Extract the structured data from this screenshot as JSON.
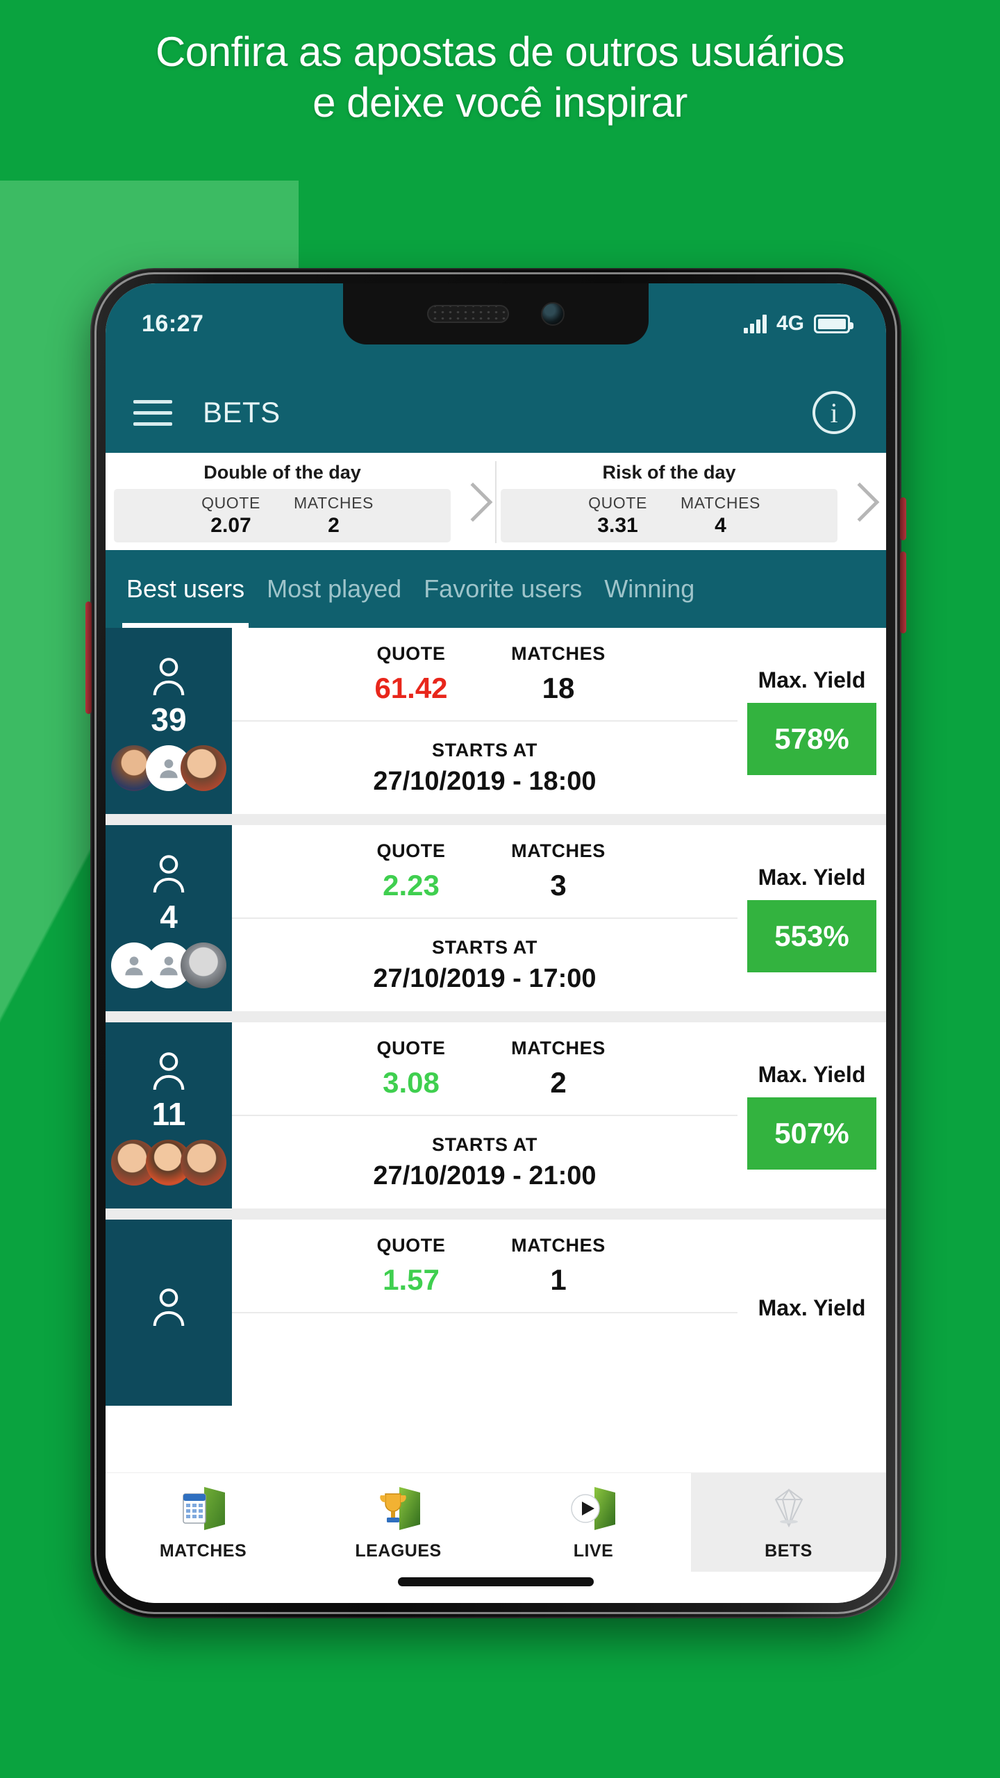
{
  "promo_banner": {
    "line1": "Confira as apostas de outros usuários",
    "line2": "e deixe você inspirar"
  },
  "colors": {
    "background_green": "#0aa33f",
    "teal_header": "#10606e",
    "teal_sidebar": "#0e4a5c",
    "yield_green": "#33b33f",
    "quote_red": "#e8261b",
    "quote_green": "#3fcf4f"
  },
  "status_bar": {
    "time": "16:27",
    "network": "4G",
    "signal_icon": "signal-bars-icon",
    "battery_icon": "battery-icon"
  },
  "app_bar": {
    "menu_icon": "hamburger-menu-icon",
    "title": "BETS",
    "info_icon": "info-icon",
    "info_glyph": "i"
  },
  "promos": [
    {
      "title": "Double of the day",
      "quote_label": "QUOTE",
      "quote_value": "2.07",
      "matches_label": "MATCHES",
      "matches_value": "2",
      "chevron_icon": "chevron-right-icon"
    },
    {
      "title": "Risk of the day",
      "quote_label": "QUOTE",
      "quote_value": "3.31",
      "matches_label": "MATCHES",
      "matches_value": "4",
      "chevron_icon": "chevron-right-icon"
    }
  ],
  "tabs": [
    {
      "label": "Best users",
      "active": true
    },
    {
      "label": "Most played",
      "active": false
    },
    {
      "label": "Favorite users",
      "active": false
    },
    {
      "label": "Winning",
      "active": false
    }
  ],
  "labels": {
    "quote": "QUOTE",
    "matches": "MATCHES",
    "starts_at": "STARTS AT",
    "max_yield": "Max. Yield",
    "person_icon": "person-icon"
  },
  "bets": [
    {
      "user_count": "39",
      "quote": "61.42",
      "quote_color": "red",
      "matches": "18",
      "starts_at": "27/10/2019 - 18:00",
      "max_yield": "578%",
      "avatars": [
        "photo-a",
        "placeholder",
        "photo-b"
      ]
    },
    {
      "user_count": "4",
      "quote": "2.23",
      "quote_color": "green",
      "matches": "3",
      "starts_at": "27/10/2019 - 17:00",
      "max_yield": "553%",
      "avatars": [
        "placeholder",
        "placeholder",
        "photo-c"
      ]
    },
    {
      "user_count": "11",
      "quote": "3.08",
      "quote_color": "green",
      "matches": "2",
      "starts_at": "27/10/2019 - 21:00",
      "max_yield": "507%",
      "avatars": [
        "photo-b",
        "photo-d",
        "photo-b"
      ]
    },
    {
      "user_count": "",
      "quote": "1.57",
      "quote_color": "green",
      "matches": "1",
      "starts_at": "",
      "max_yield": "",
      "avatars": []
    }
  ],
  "bottom_nav": [
    {
      "label": "MATCHES",
      "icon": "calendar-field-icon",
      "active": false
    },
    {
      "label": "LEAGUES",
      "icon": "trophy-field-icon",
      "active": false
    },
    {
      "label": "LIVE",
      "icon": "play-field-icon",
      "active": false
    },
    {
      "label": "BETS",
      "icon": "diamond-icon",
      "active": true
    }
  ]
}
